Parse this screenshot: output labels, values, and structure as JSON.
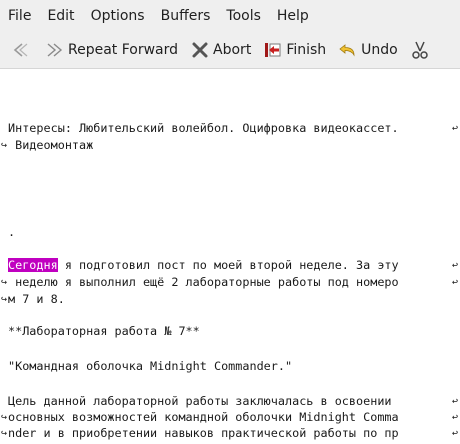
{
  "menubar": {
    "items": [
      "File",
      "Edit",
      "Options",
      "Buffers",
      "Tools",
      "Help"
    ]
  },
  "toolbar": {
    "back_icon": "back-arrow-icon",
    "repeat_forward_label": "Repeat Forward",
    "abort_label": "Abort",
    "finish_label": "Finish",
    "undo_label": "Undo"
  },
  "editor": {
    "line1": "Интересы: Любительский волейбол. Оцифровка видеокассет.",
    "line2": " Видеомонтаж",
    "line3": ".",
    "line4_highlight": "Сегодня",
    "line4_rest": " я подготовил пост по моей второй неделе. За эту",
    "line5": " неделю я выполнил ещё 2 лабораторные работы под номеро",
    "line6": "м 7 и 8.",
    "line7": "**Лабораторная работа № 7**",
    "line8": "\"Командная оболочка Midnight Commander.\"",
    "line9": "Цель данной лабораторной работы заключалась в освоении",
    "line10": "основных возможностей командной оболочки Midnight Comma",
    "line11": "nder и в приобретении навыков практической работы по пр"
  },
  "colors": {
    "highlight": "#c000c0",
    "chrome": "#efefef"
  }
}
